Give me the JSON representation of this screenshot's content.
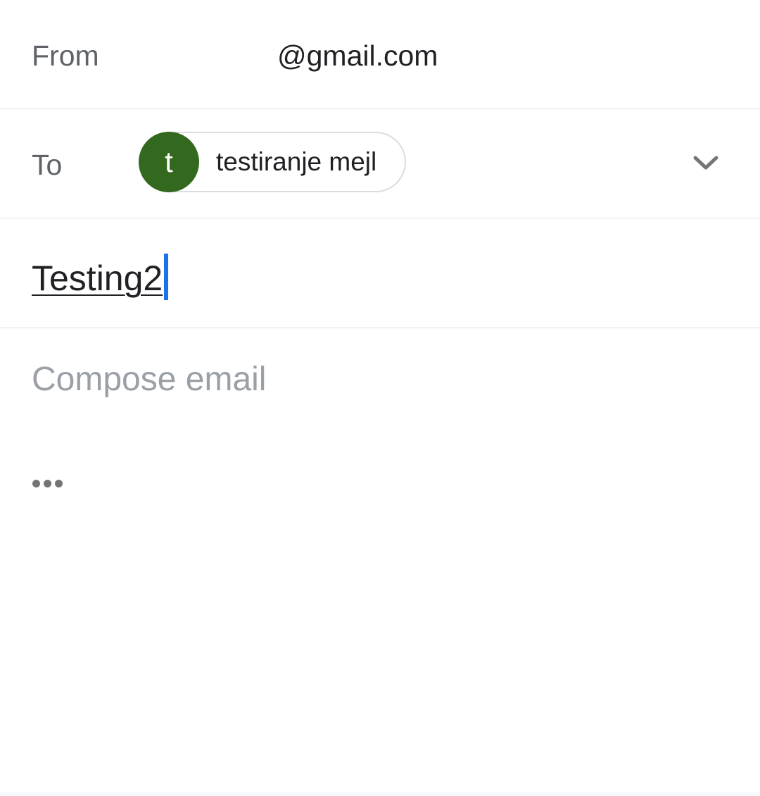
{
  "compose": {
    "from": {
      "label": "From",
      "address_visible": "@gmail.com"
    },
    "to": {
      "label": "To",
      "recipient_initial": "t",
      "recipient_name": "testiranje mejl",
      "avatar_color": "#33691e",
      "expand_icon": "chevron-down-icon"
    },
    "subject": {
      "value": "Testing2",
      "caret_color": "#1a73e8"
    },
    "body": {
      "placeholder": "Compose email"
    },
    "more_icon": "more-horiz-icon"
  }
}
